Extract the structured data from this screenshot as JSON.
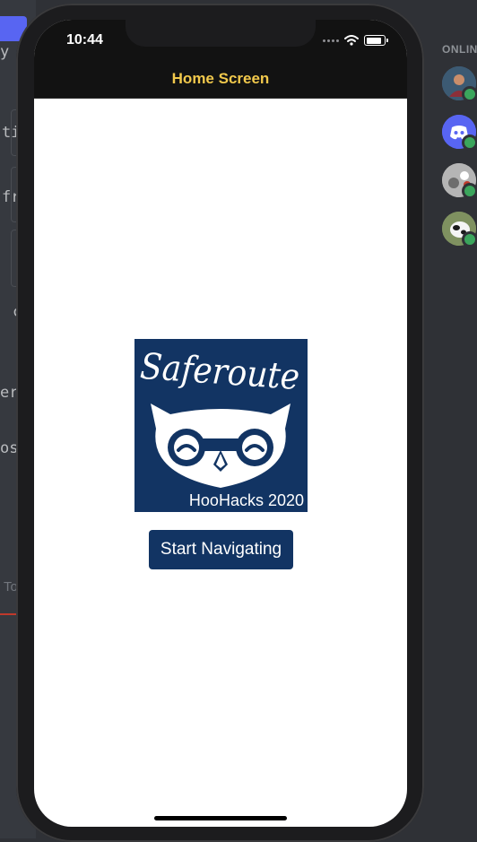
{
  "background": {
    "left_fragments": [
      "y",
      "ti",
      "fr",
      "c",
      "er",
      "os",
      "To"
    ],
    "members_header": "ONLIN"
  },
  "status_bar": {
    "time": "10:44",
    "icons": [
      "cellular-dots-icon",
      "wifi-icon",
      "battery-icon"
    ]
  },
  "nav": {
    "title": "Home Screen"
  },
  "logo": {
    "wordmark": "Saferoute",
    "caption": "HooHacks 2020"
  },
  "actions": {
    "start_label": "Start Navigating"
  },
  "colors": {
    "nav_title": "#f2c94c",
    "brand_navy": "#123463",
    "nav_bar": "#121212",
    "online_status": "#3ba55c"
  }
}
